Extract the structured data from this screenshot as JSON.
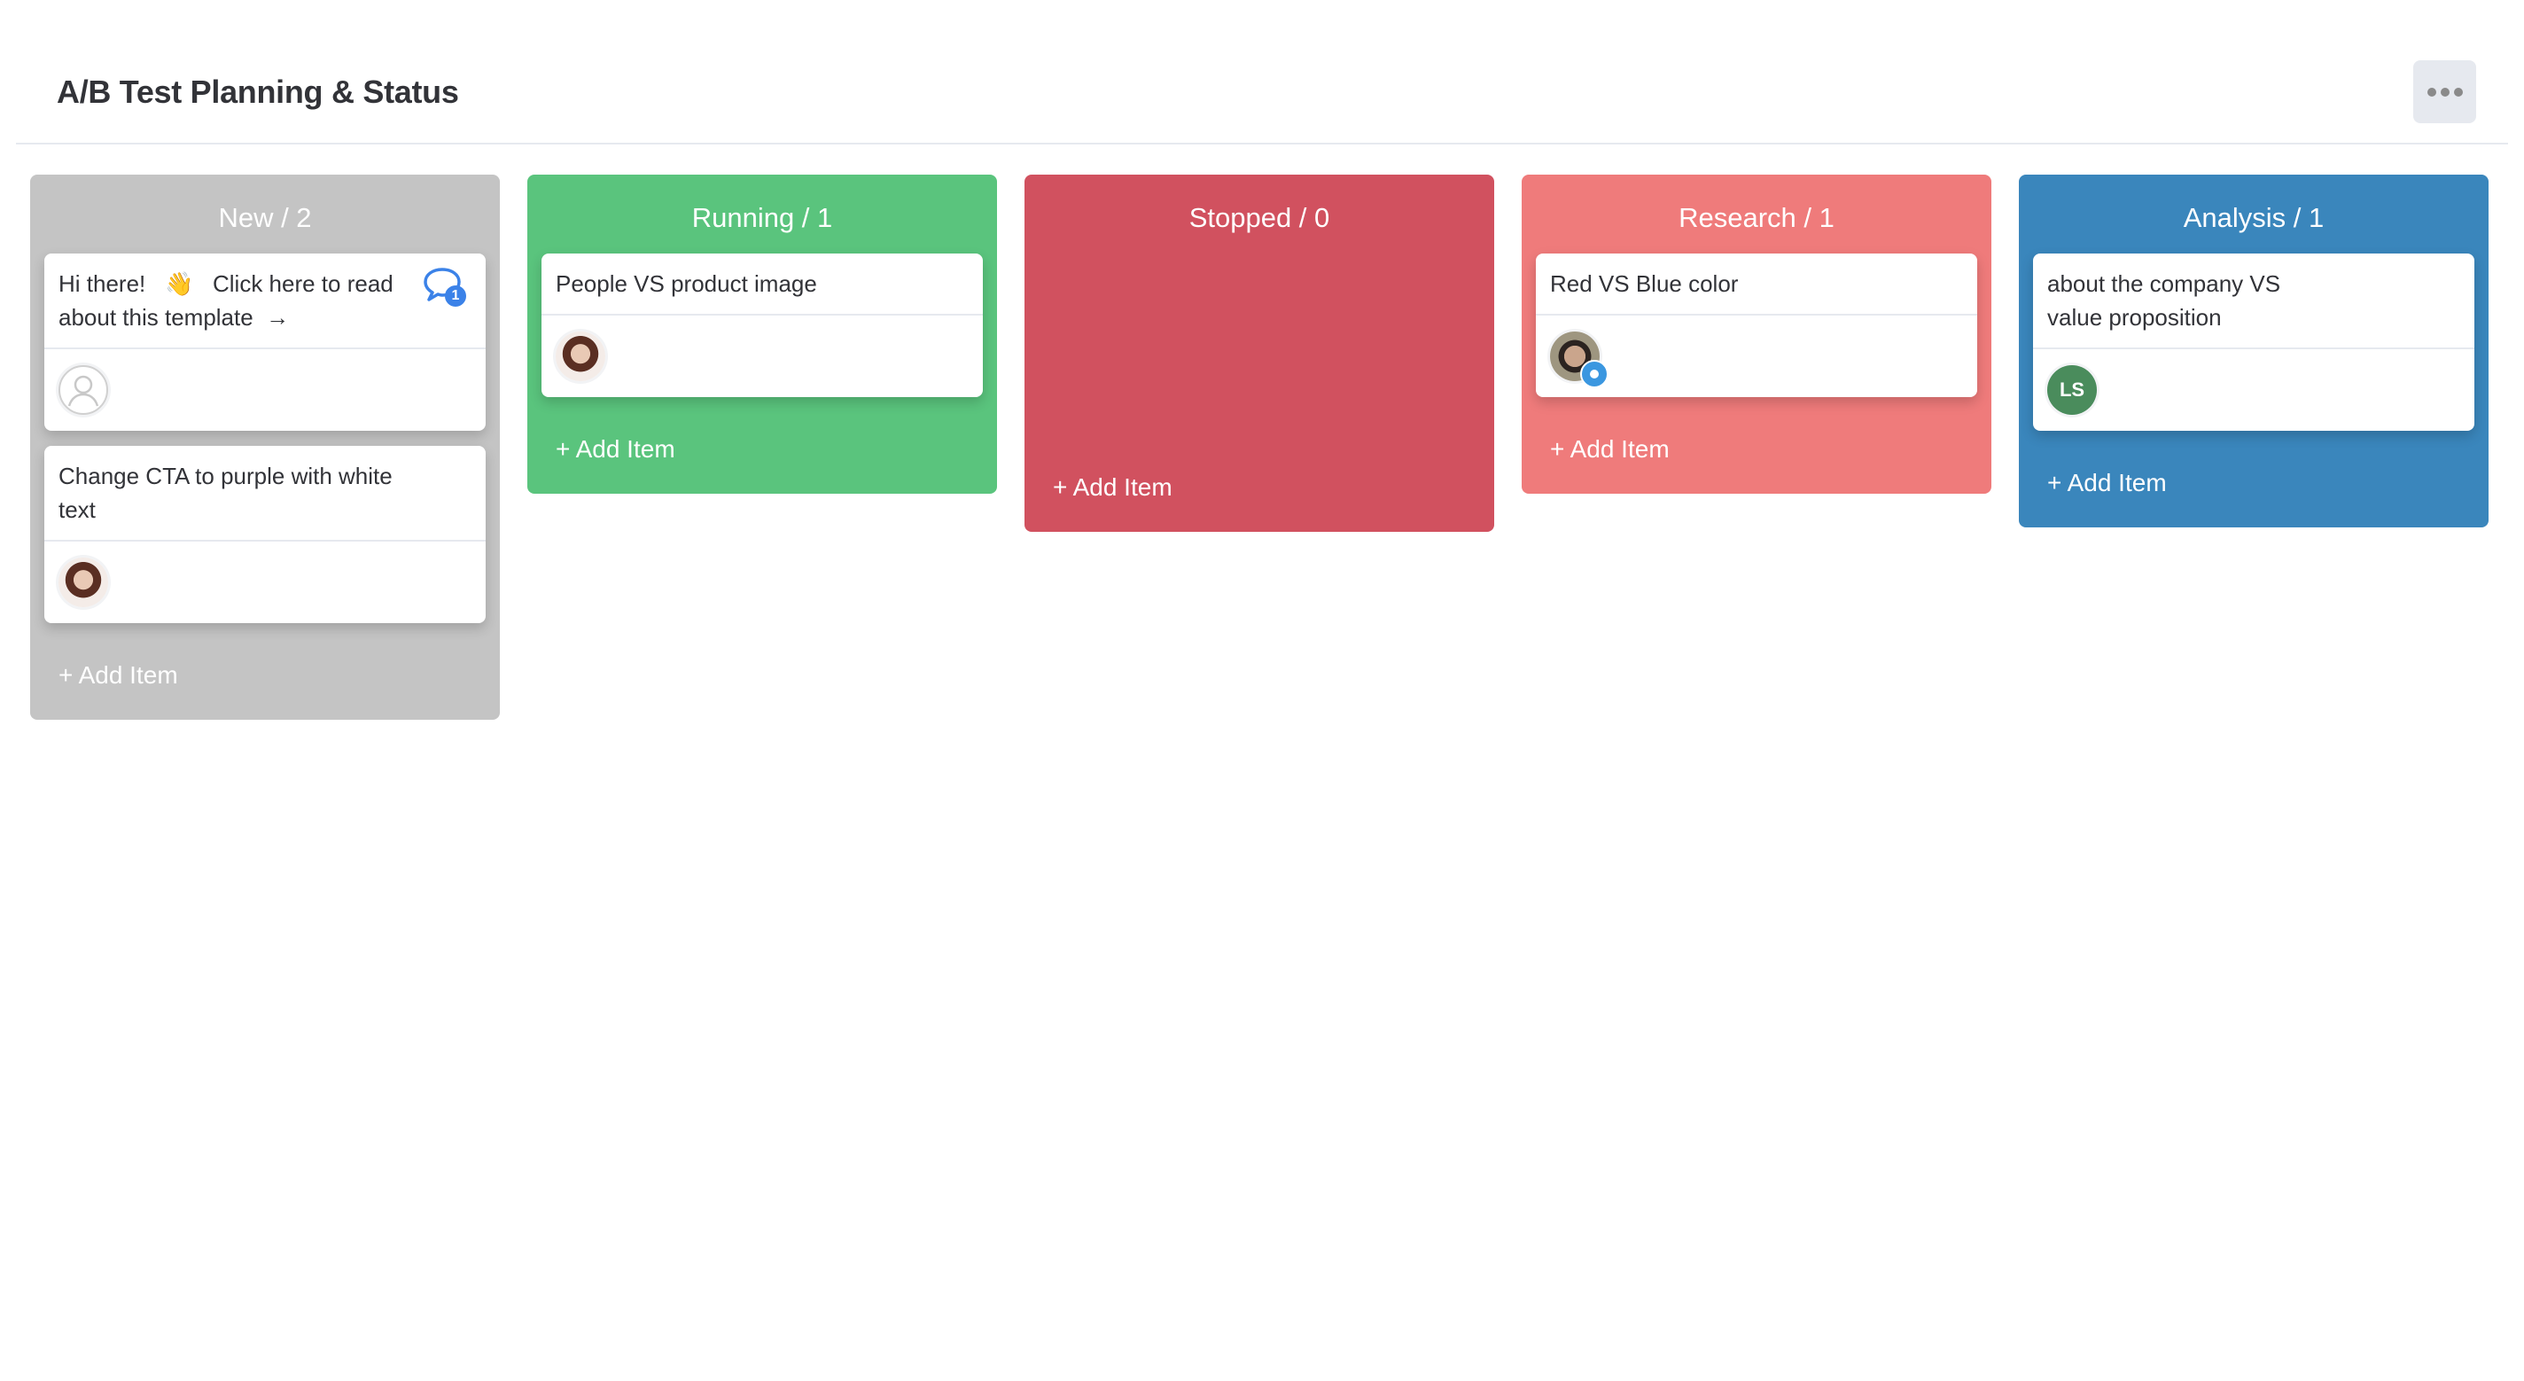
{
  "header": {
    "title": "A/B Test Planning & Status",
    "menu_icon": "more-horizontal-icon"
  },
  "columns": [
    {
      "id": "new",
      "title": "New / 2",
      "color": "#c4c4c4",
      "add_label": "+ Add Item",
      "cards": [
        {
          "title_part1": "Hi there!",
          "emoji": "👋",
          "title_part2": "Click here to read about this template",
          "arrow": "→",
          "comment_count": "1",
          "assignee": {
            "type": "empty",
            "icon": "person-icon"
          }
        },
        {
          "title": "Change CTA to purple with white text",
          "assignee": {
            "type": "photo"
          }
        }
      ]
    },
    {
      "id": "running",
      "title": "Running / 1",
      "color": "#5ac47d",
      "add_label": "+ Add Item",
      "cards": [
        {
          "title": "People VS product image",
          "assignee": {
            "type": "photo"
          }
        }
      ]
    },
    {
      "id": "stopped",
      "title": "Stopped / 0",
      "color": "#d1515f",
      "add_label": "+ Add Item",
      "cards": []
    },
    {
      "id": "research",
      "title": "Research / 1",
      "color": "#ef7b7b",
      "add_label": "+ Add Item",
      "cards": [
        {
          "title": "Red VS Blue color",
          "assignee": {
            "type": "photo",
            "badge": "eye-icon"
          }
        }
      ]
    },
    {
      "id": "analysis",
      "title": "Analysis / 1",
      "color": "#3a86bc",
      "add_label": "+ Add Item",
      "cards": [
        {
          "title": "about the company VS value proposition",
          "assignee": {
            "type": "initials",
            "initials": "LS",
            "color": "#4a8c5c"
          }
        }
      ]
    }
  ]
}
